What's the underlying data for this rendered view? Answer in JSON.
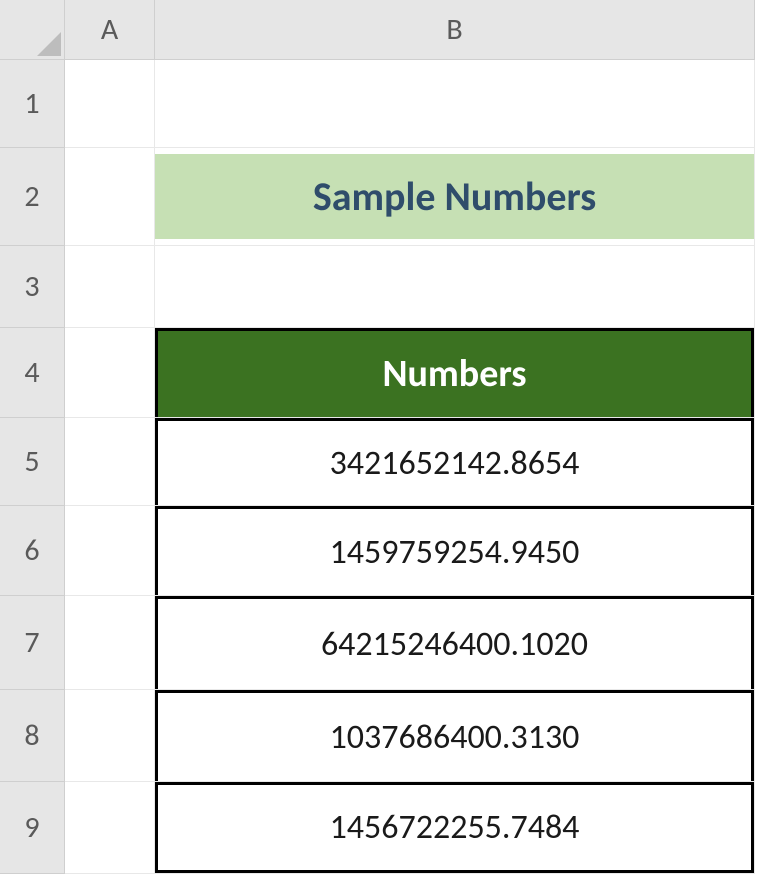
{
  "columns": {
    "A": "A",
    "B": "B"
  },
  "rows": {
    "r1": "1",
    "r2": "2",
    "r3": "3",
    "r4": "4",
    "r5": "5",
    "r6": "6",
    "r7": "7",
    "r8": "8",
    "r9": "9"
  },
  "title": "Sample Numbers",
  "table": {
    "header": "Numbers",
    "values": [
      "3421652142.8654",
      "1459759254.9450",
      "64215246400.1020",
      "1037686400.3130",
      "1456722255.7484"
    ]
  },
  "chart_data": {
    "type": "table",
    "title": "Sample Numbers",
    "columns": [
      "Numbers"
    ],
    "rows": [
      [
        3421652142.8654
      ],
      [
        1459759254.945
      ],
      [
        64215246400.102
      ],
      [
        1037686400.313
      ],
      [
        1456722255.7484
      ]
    ]
  }
}
